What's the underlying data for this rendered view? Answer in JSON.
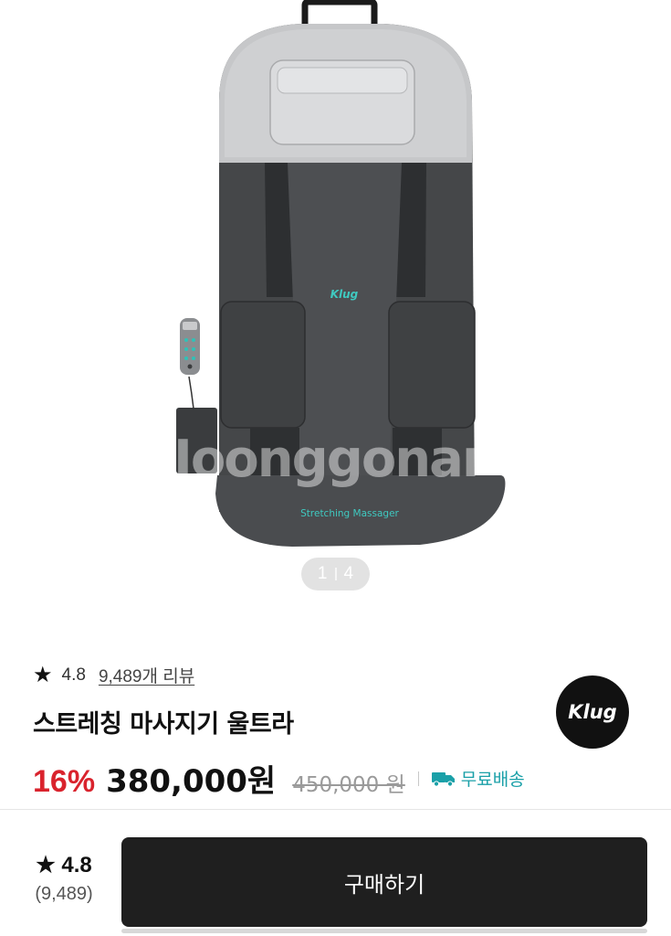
{
  "product": {
    "image": {
      "alt": "Stretching Massager seat pad",
      "brand_print": "Klug",
      "print_text": "Stretching Massager",
      "watermark": "Joonggonara"
    },
    "pager": {
      "current": "1",
      "total": "4"
    },
    "rating": {
      "score": "4.8",
      "reviews_link": "9,489개 리뷰"
    },
    "title": "스트레칭 마사지기 울트라",
    "brand_logo": "Klug",
    "price": {
      "discount": "16%",
      "current": "380,000원",
      "original": "450,000 원"
    },
    "shipping": {
      "label": "무료배송",
      "icon": "truck-icon",
      "color": "#1aa0a8"
    }
  },
  "bottom_bar": {
    "rating": "★ 4.8",
    "review_count": "(9,489)",
    "buy_label": "구매하기"
  },
  "colors": {
    "discount": "#d9232d",
    "buy_button": "#1f1f1f",
    "accent": "#1aa0a8"
  }
}
